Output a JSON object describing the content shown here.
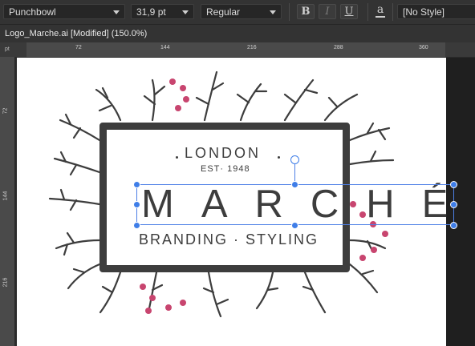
{
  "toolbar": {
    "font_family": "Punchbowl",
    "font_size": "31,9 pt",
    "font_style": "Regular",
    "bold_label": "B",
    "italic_label": "I",
    "underline_label": "U",
    "color_label": "a",
    "paragraph_style": "[No Style]"
  },
  "document": {
    "title": "Logo_Marche.ai [Modified] (150.0%)"
  },
  "rulers": {
    "unit": "pt",
    "top_ticks": [
      "72",
      "144",
      "216",
      "288",
      "360"
    ],
    "left_ticks": [
      "72",
      "144",
      "216"
    ]
  },
  "artwork": {
    "line1": "LONDON",
    "line2": "EST· 1948",
    "line3": "MARCHÉ",
    "line4": "BRANDING · STYLING",
    "ink_color": "#3d3d3d",
    "berry_color": "#c8456f"
  }
}
